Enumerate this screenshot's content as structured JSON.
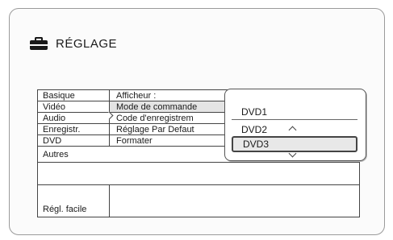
{
  "header": {
    "title": "RÉGLAGE",
    "icon": "toolbox-icon"
  },
  "categories": [
    "Basique",
    "Vidéo",
    "Audio",
    "Enregistr.",
    "DVD"
  ],
  "full_rows": [
    "Autres",
    "",
    "Régl. facile"
  ],
  "settings": [
    "Afficheur :",
    "Mode de commande",
    "Code d'enregistrem",
    "Réglage Par Defaut",
    "Formater"
  ],
  "popup": {
    "options": [
      "DVD1",
      "DVD2",
      "DVD3"
    ],
    "selected": "DVD3"
  }
}
